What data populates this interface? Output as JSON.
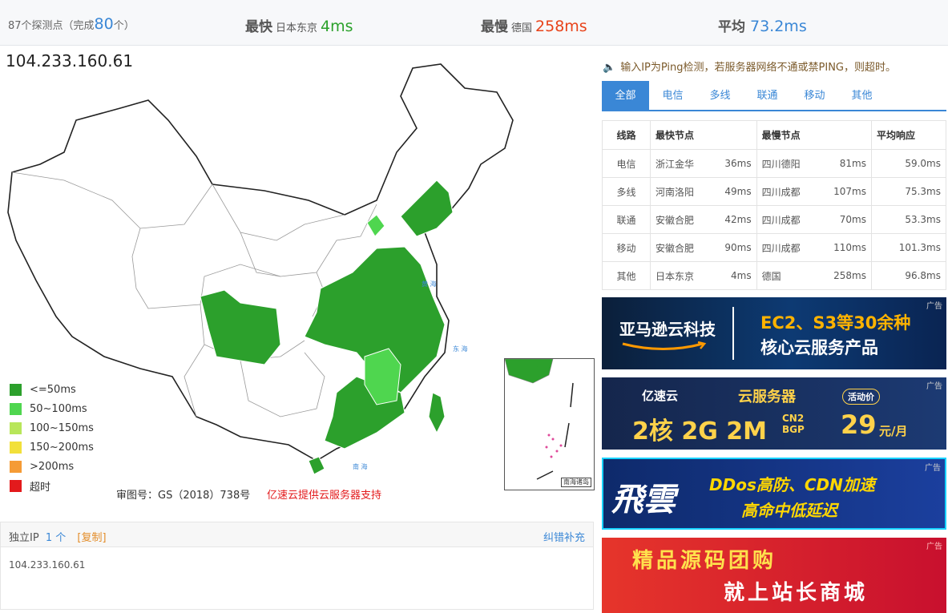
{
  "summary": {
    "probes_prefix": "87个探测点（完成",
    "probes_done": "80",
    "probes_suffix": "个）",
    "fastest_label": "最快",
    "fastest_loc": "日本东京",
    "fastest_val": "4ms",
    "slowest_label": "最慢",
    "slowest_loc": "德国",
    "slowest_val": "258ms",
    "avg_label": "平均",
    "avg_val": "73.2ms"
  },
  "target_ip": "104.233.160.61",
  "legend": [
    {
      "label": "<=50ms",
      "color": "#2ca02c"
    },
    {
      "label": "50~100ms",
      "color": "#4fd64f"
    },
    {
      "label": "100~150ms",
      "color": "#b8e65a"
    },
    {
      "label": "150~200ms",
      "color": "#f2e03a"
    },
    {
      "label": ">200ms",
      "color": "#f59b35"
    },
    {
      "label": "超时",
      "color": "#e31a1c"
    }
  ],
  "map": {
    "approval": "审图号：GS（2018）738号",
    "sponsor": "亿速云提供云服务器支持",
    "inset_caption": "南海诸岛"
  },
  "ipbox": {
    "label": "独立IP",
    "count": "1 个",
    "copy": "[复制]",
    "correction": "纠错补充",
    "ip": "104.233.160.61"
  },
  "notice": "输入IP为Ping检测，若服务器网络不通或禁PING，则超时。",
  "tabs": [
    "全部",
    "电信",
    "多线",
    "联通",
    "移动",
    "其他"
  ],
  "table": {
    "headers": [
      "线路",
      "最快节点",
      "最慢节点",
      "平均响应"
    ],
    "rows": [
      {
        "line": "电信",
        "fast": "浙江金华",
        "fast_ms": "36ms",
        "slow": "四川德阳",
        "slow_ms": "81ms",
        "avg": "59.0ms"
      },
      {
        "line": "多线",
        "fast": "河南洛阳",
        "fast_ms": "49ms",
        "slow": "四川成都",
        "slow_ms": "107ms",
        "avg": "75.3ms"
      },
      {
        "line": "联通",
        "fast": "安徽合肥",
        "fast_ms": "42ms",
        "slow": "四川成都",
        "slow_ms": "70ms",
        "avg": "53.3ms"
      },
      {
        "line": "移动",
        "fast": "安徽合肥",
        "fast_ms": "90ms",
        "slow": "四川成都",
        "slow_ms": "110ms",
        "avg": "101.3ms"
      },
      {
        "line": "其他",
        "fast": "日本东京",
        "fast_ms": "4ms",
        "slow": "德国",
        "slow_ms": "258ms",
        "avg": "96.8ms"
      }
    ]
  },
  "ads": {
    "tag": "广告",
    "ad1_brand": "亚马逊云科技",
    "ad1_line1": "EC2、S3等30余种",
    "ad1_line2": "核心云服务产品",
    "ad2_brand": "亿速云",
    "ad2_title": "云服务器",
    "ad2_badge": "活动价",
    "ad2_spec": "2核 2G 2M",
    "ad2_cn": "CN2 BGP",
    "ad2_price": "29",
    "ad2_unit": "元/月",
    "ad3_brand": "飛雲",
    "ad3_line1": "DDos高防、CDN加速",
    "ad3_line2": "高命中低延迟",
    "ad4_line1": "精品源码团购",
    "ad4_line2": "就上站长商城"
  }
}
